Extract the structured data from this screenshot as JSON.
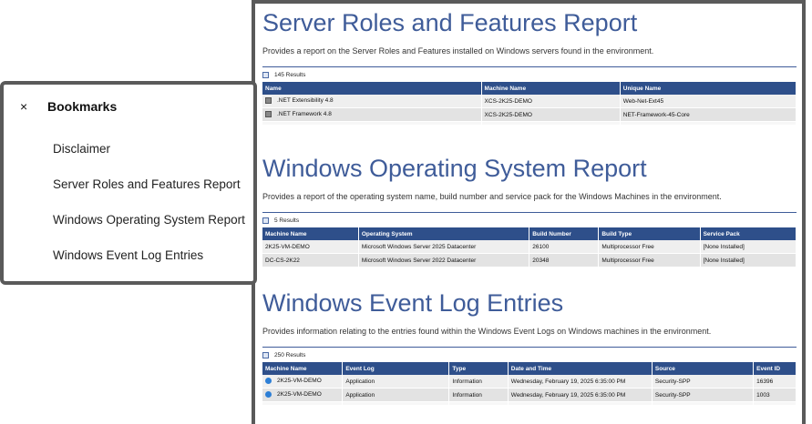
{
  "bookmarks": {
    "title": "Bookmarks",
    "close": "×",
    "items": [
      "Disclaimer",
      "Server Roles and Features Report",
      "Windows Operating System Report",
      "Windows Event Log Entries"
    ]
  },
  "sections": {
    "roles": {
      "title": "Server Roles and Features Report",
      "description": "Provides a report on the Server Roles and Features installed on Windows servers found in the environment.",
      "results": "145 Results",
      "headers": [
        "Name",
        "Machine Name",
        "Unique Name"
      ],
      "rows": [
        [
          ".NET Extensibility 4.8",
          "XCS-2K25-DEMO",
          "Web-Net-Ext45"
        ],
        [
          ".NET Framework 4.8",
          "XCS-2K25-DEMO",
          "NET-Framework-45-Core"
        ]
      ]
    },
    "os": {
      "title": "Windows Operating System Report",
      "description": "Provides a report of the operating system name, build number and service pack for the Windows Machines in the environment.",
      "results": "5 Results",
      "headers": [
        "Machine Name",
        "Operating System",
        "Build Number",
        "Build Type",
        "Service Pack"
      ],
      "rows": [
        [
          "2K25-VM-DEMO",
          "Microsoft Windows Server 2025 Datacenter",
          "26100",
          "Multiprocessor Free",
          "[None Installed]"
        ],
        [
          "DC-CS-2K22",
          "Microsoft Windows Server 2022 Datacenter",
          "20348",
          "Multiprocessor Free",
          "[None Installed]"
        ]
      ]
    },
    "events": {
      "title": "Windows Event Log Entries",
      "description": "Provides information relating to the entries found within the Windows Event Logs on Windows machines in the environment.",
      "results": "250 Results",
      "headers": [
        "Machine Name",
        "Event Log",
        "Type",
        "Date and Time",
        "Source",
        "Event ID"
      ],
      "rows": [
        [
          "2K25-VM-DEMO",
          "Application",
          "Information",
          "Wednesday, February 19, 2025 6:35:00 PM",
          "Security-SPP",
          "16396"
        ],
        [
          "2K25-VM-DEMO",
          "Application",
          "Information",
          "Wednesday, February 19, 2025 6:35:00 PM",
          "Security-SPP",
          "1003"
        ]
      ]
    }
  },
  "colors": {
    "title_blue": "#3f5c99",
    "header_blue": "#2e4f8a",
    "frame_gray": "#5a5a5a"
  },
  "icons": {
    "results": "report-icon",
    "roles_row": "server-icon",
    "events_row": "info-icon"
  }
}
